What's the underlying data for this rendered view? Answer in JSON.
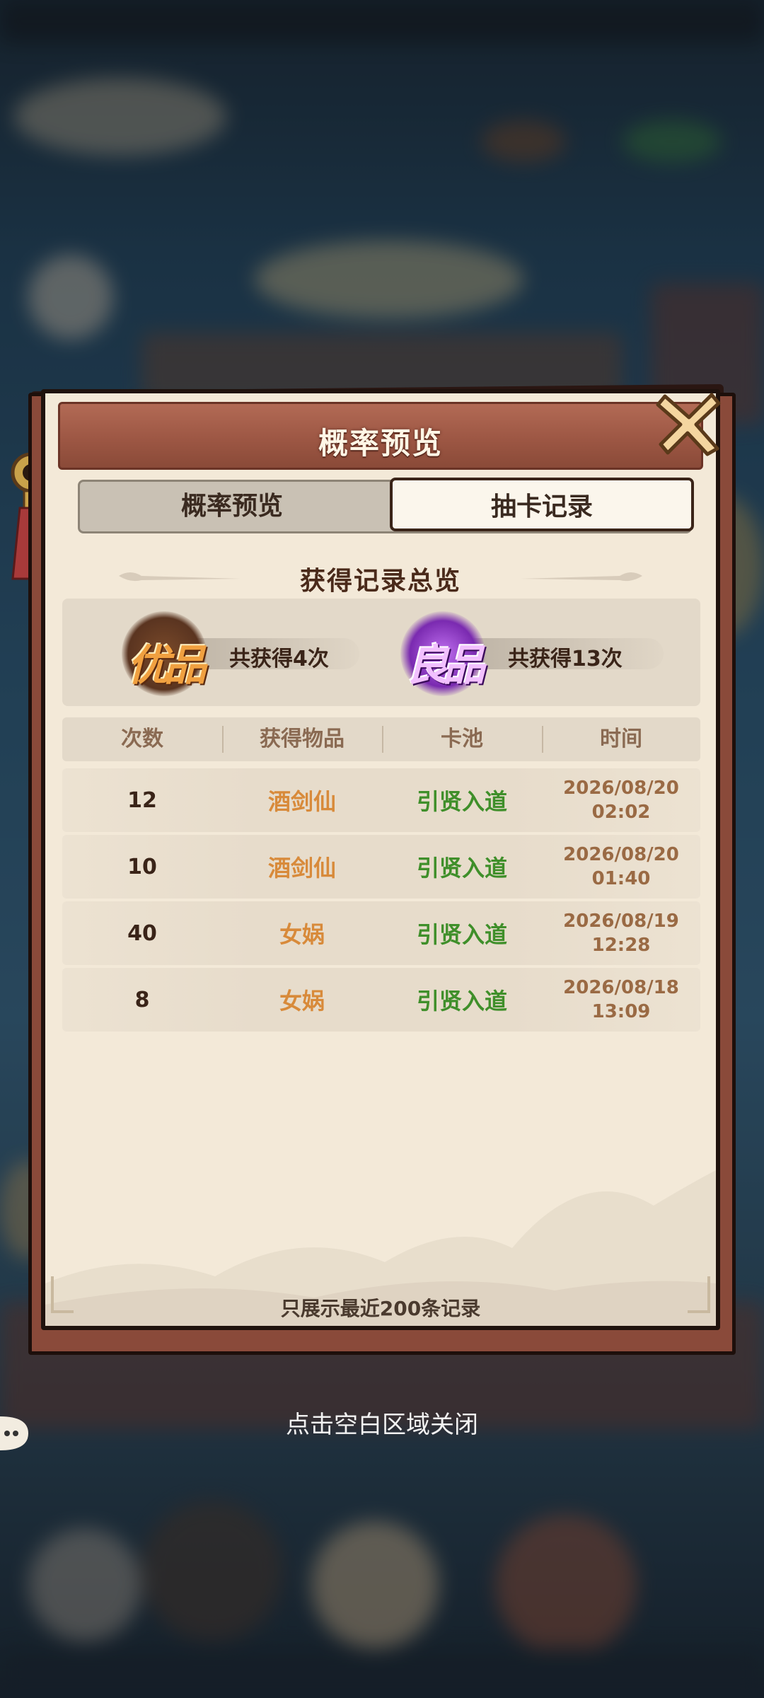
{
  "modal": {
    "title": "概率预览",
    "tabs": [
      {
        "label": "概率预览",
        "active": false
      },
      {
        "label": "抽卡记录",
        "active": true
      }
    ],
    "summary": {
      "title": "获得记录总览",
      "entries": [
        {
          "badge": "优品",
          "count_text": "共获得4次",
          "color": "#e69a3c"
        },
        {
          "badge": "良品",
          "count_text": "共获得13次",
          "color": "#a24bd0"
        }
      ]
    },
    "table": {
      "headers": [
        "次数",
        "获得物品",
        "卡池",
        "时间"
      ],
      "rows": [
        {
          "count": "12",
          "item": "酒剑仙",
          "pool": "引贤入道",
          "date": "2026/08/20",
          "time": "02:02"
        },
        {
          "count": "10",
          "item": "酒剑仙",
          "pool": "引贤入道",
          "date": "2026/08/20",
          "time": "01:40"
        },
        {
          "count": "40",
          "item": "女娲",
          "pool": "引贤入道",
          "date": "2026/08/19",
          "time": "12:28"
        },
        {
          "count": "8",
          "item": "女娲",
          "pool": "引贤入道",
          "date": "2026/08/18",
          "time": "13:09"
        }
      ]
    },
    "footer_note": "只展示最近200条记录"
  },
  "dismiss_hint": "点击空白区域关闭",
  "colors": {
    "header": "#9d5744",
    "item_text": "#d88a3a",
    "pool_text": "#3f8f2a",
    "panel_bg": "#f3e9d8"
  }
}
